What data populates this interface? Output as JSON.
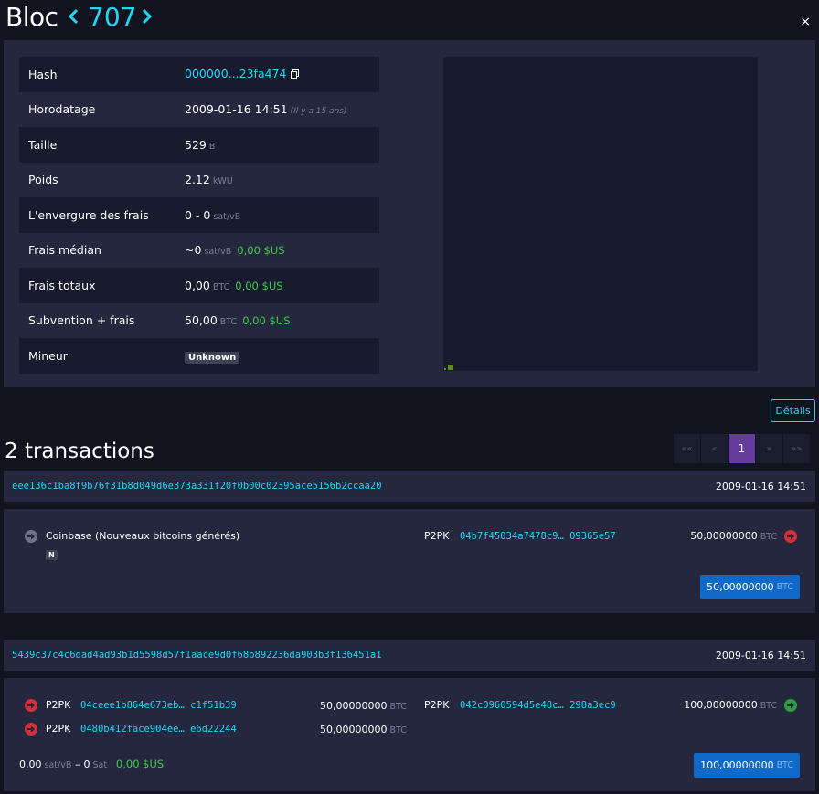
{
  "header": {
    "title": "Bloc",
    "block_height": "707",
    "close_label": "×"
  },
  "block": {
    "rows": [
      {
        "key": "Hash",
        "value": "000000...23fa474",
        "kind": "hash"
      },
      {
        "key": "Horodatage",
        "value": "2009-01-16 14:51",
        "ago": "(Il y a 15 ans)",
        "kind": "time"
      },
      {
        "key": "Taille",
        "value": "529",
        "unit": "B",
        "kind": "unit"
      },
      {
        "key": "Poids",
        "value": "2.12",
        "unit": "kWU",
        "kind": "unit"
      },
      {
        "key": "L'envergure des frais",
        "value": "0 - 0",
        "unit": "sat/vB",
        "kind": "unit"
      },
      {
        "key": "Frais médian",
        "value": "~0",
        "unit": "sat/vB",
        "usd": "0,00 $US",
        "kind": "usd"
      },
      {
        "key": "Frais totaux",
        "value": "0,00",
        "unit": "BTC",
        "usd": "0,00 $US",
        "kind": "usd"
      },
      {
        "key": "Subvention + frais",
        "value": "50,00",
        "unit": "BTC",
        "usd": "0,00 $US",
        "kind": "usd"
      },
      {
        "key": "Mineur",
        "value": "Unknown",
        "kind": "badge"
      }
    ]
  },
  "details_button": "Détails",
  "transactions": {
    "count_label": "2 transactions",
    "pager": [
      "««",
      "«",
      "1",
      "»",
      "»»"
    ],
    "pager_active_index": 2
  },
  "tx1": {
    "txid": "eee136c1ba8f9b76f31b8d049d6e373a331f20f0b00c02395ace5156b2ccaa20",
    "timestamp": "2009-01-16 14:51",
    "input_label": "Coinbase (Nouveaux bitcoins générés)",
    "input_badge": "N",
    "output_type": "P2PK",
    "output_addr": "04b7f45034a7478c9… 09365e57",
    "output_amount": "50,00000000",
    "unit": "BTC",
    "total": "50,00000000"
  },
  "tx2": {
    "txid": "5439c37c4c6dad4ad93b1d5598d57f1aace9d0f68b892236da903b3f136451a1",
    "timestamp": "2009-01-16 14:51",
    "inputs": [
      {
        "type": "P2PK",
        "addr": "04ceee1b864e673eb… c1f51b39",
        "amount": "50,00000000"
      },
      {
        "type": "P2PK",
        "addr": "0480b412face904ee… e6d22244",
        "amount": "50,00000000"
      }
    ],
    "output_type": "P2PK",
    "output_addr": "042c0960594d5e48c… 298a3ec9",
    "output_amount": "100,00000000",
    "unit": "BTC",
    "fee_rate": "0,00",
    "fee_rate_unit": "sat/vB",
    "fee_sep": "–",
    "fee_sat": "0",
    "fee_sat_unit": "Sat",
    "fee_usd": "0,00 $US",
    "total": "100,00000000"
  }
}
